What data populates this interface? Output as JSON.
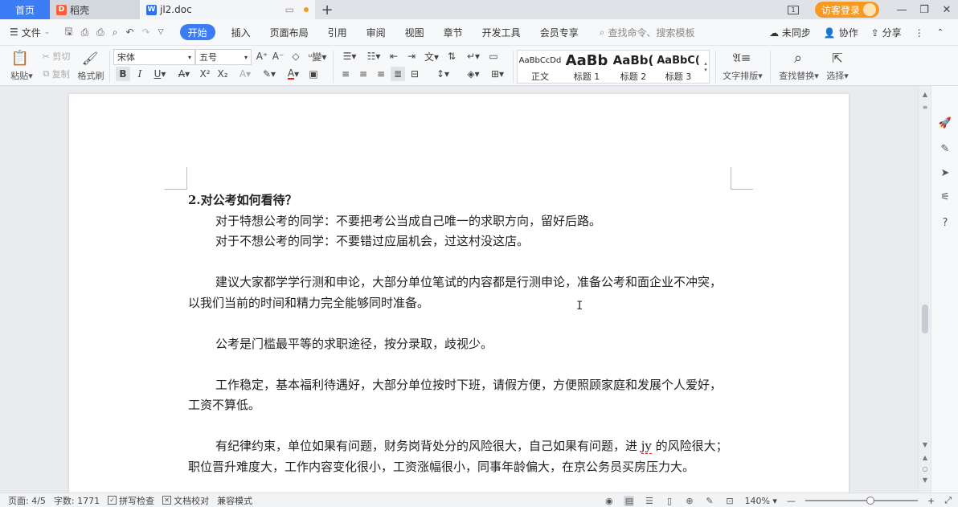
{
  "tabs": {
    "home": "首页",
    "daoke": "稻壳",
    "doc": "jl2.doc",
    "add": "+"
  },
  "titlebar": {
    "login": "访客登录"
  },
  "menu": {
    "file": "文件",
    "items": [
      "开始",
      "插入",
      "页面布局",
      "引用",
      "审阅",
      "视图",
      "章节",
      "开发工具",
      "会员专享"
    ],
    "search": "查找命令、搜索模板",
    "unsync": "未同步",
    "collab": "协作",
    "share": "分享"
  },
  "ribbon": {
    "paste": "粘贴",
    "cut": "剪切",
    "copy": "复制",
    "format_painter": "格式刷",
    "font_name": "宋体",
    "font_size": "五号",
    "styles": [
      {
        "sample": "AaBbCcDd",
        "label": "正文"
      },
      {
        "sample": "AaBb",
        "label": "标题 1"
      },
      {
        "sample": "AaBb(",
        "label": "标题 2"
      },
      {
        "sample": "AaBbC(",
        "label": "标题 3"
      }
    ],
    "text_layout": "文字排版",
    "find_replace": "查找替换",
    "select": "选择"
  },
  "document": {
    "heading": "2.对公考如何看待？",
    "line1": "对于特想公考的同学：不要把考公当成自己唯一的求职方向，留好后路。",
    "line2": "对于不想公考的同学：不要错过应届机会，过这村没这店。",
    "para1": "建议大家都学学行测和申论，大部分单位笔试的内容都是行测申论，准备公考和面企业不冲突，以我们当前的时间和精力完全能够同时准备。",
    "para2": "公考是门槛最平等的求职途径，按分录取，歧视少。",
    "para3": "工作稳定，基本福利待遇好，大部分单位按时下班，请假方便，方便照顾家庭和发展个人爱好，工资不算低。",
    "para4_a": "有纪律约束，单位如果有问题，财务岗背处分的风险很大，自己如果有问题，进 ",
    "para4_err": "jy",
    "para4_b": " 的风险很大；职位晋升难度大，工作内容变化很小，工资涨幅很小，同事年龄偏大，在京公务员买房压力大。"
  },
  "status": {
    "page": "页面: 4/5",
    "words": "字数: 1771",
    "spell": "拼写检查",
    "proofread": "文档校对",
    "compat": "兼容模式",
    "zoom": "140%"
  },
  "colors": {
    "accent": "#3c7cf5",
    "login_btn": "#f59a23"
  }
}
